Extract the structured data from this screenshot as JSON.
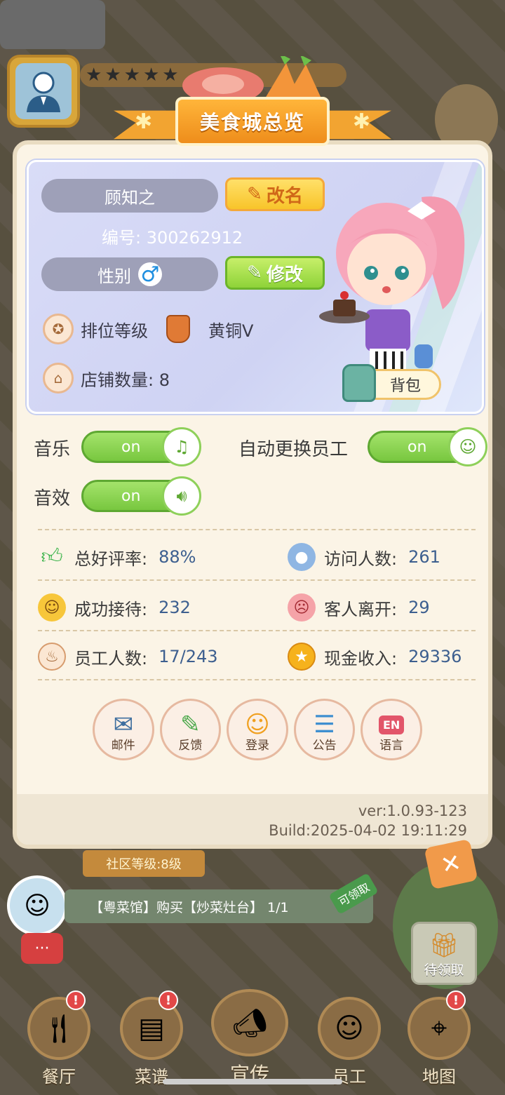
{
  "panel": {
    "title": "美食城总览",
    "profile": {
      "name": "顾知之",
      "rename_label": "改名",
      "id_text": "编号: 300262912",
      "gender_label": "性别",
      "gender_symbol": "♂",
      "modify_label": "修改",
      "rank_label": "排位等级",
      "rank_value": "黄铜V",
      "shops_label": "店铺数量: 8",
      "backpack_label": "背包"
    },
    "settings": {
      "music_label": "音乐",
      "music_state": "on",
      "sfx_label": "音效",
      "sfx_state": "on",
      "auto_staff_label": "自动更换员工",
      "auto_staff_state": "on"
    },
    "stats": {
      "rating_label": "总好评率:",
      "rating_value": "88%",
      "visitors_label": "访问人数:",
      "visitors_value": "261",
      "served_label": "成功接待:",
      "served_value": "232",
      "left_label": "客人离开:",
      "left_value": "29",
      "staff_label": "员工人数:",
      "staff_value": "17/243",
      "cash_label": "现金收入:",
      "cash_value": "29336"
    },
    "actions": [
      {
        "label": "邮件",
        "icon": "mail-icon"
      },
      {
        "label": "反馈",
        "icon": "feedback-icon"
      },
      {
        "label": "登录",
        "icon": "login-icon"
      },
      {
        "label": "公告",
        "icon": "notice-icon"
      },
      {
        "label": "语言",
        "icon": "language-icon"
      }
    ],
    "language_badge": "EN",
    "version": "ver:1.0.93-123",
    "build": "Build:2025-04-02 19:11:29"
  },
  "game": {
    "community_level": "社区等级:8级",
    "quest_text": "【粤菜馆】购买【炒菜灶台】 1/1",
    "quest_tag": "可领取",
    "gift_label": "待领取",
    "nav": [
      {
        "label": "餐厅",
        "badge": "!"
      },
      {
        "label": "菜谱",
        "badge": "!"
      },
      {
        "label": "宣传",
        "badge": ""
      },
      {
        "label": "员工",
        "badge": ""
      },
      {
        "label": "地图",
        "badge": "!"
      }
    ]
  }
}
